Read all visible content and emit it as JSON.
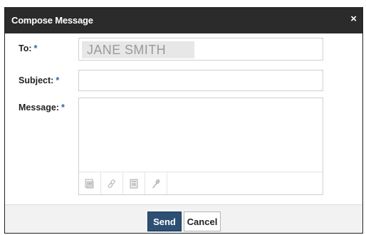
{
  "dialog": {
    "title": "Compose Message",
    "close_label": "×"
  },
  "form": {
    "to": {
      "label": "To:",
      "required_mark": "*",
      "value": "JANE SMITH"
    },
    "subject": {
      "label": "Subject:",
      "required_mark": "*",
      "value": ""
    },
    "message": {
      "label": "Message:",
      "required_mark": "*",
      "value": "",
      "toolbar_icons": [
        "insert-image-icon",
        "attach-link-icon",
        "attach-file-icon",
        "microphone-icon"
      ]
    }
  },
  "buttons": {
    "send_label": "Send",
    "cancel_label": "Cancel"
  },
  "colors": {
    "titlebar": "#2b2b2b",
    "required": "#2a5fb0",
    "send_button": "#2c4f73"
  }
}
